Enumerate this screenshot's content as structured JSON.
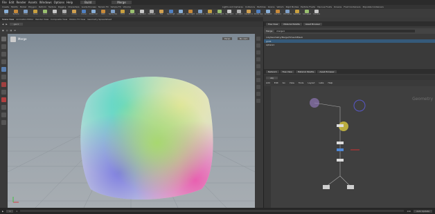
{
  "menu": [
    "File",
    "Edit",
    "Render",
    "Assets",
    "Windows",
    "Options",
    "Help",
    "Build",
    "Merge"
  ],
  "shelf_tabs": [
    "Create",
    "Modify",
    "Model",
    "Polygon",
    "Deform",
    "Texture",
    "Rigging",
    "Characters",
    "Guide Process",
    "Terrain FX",
    "Simple FX",
    "Volume",
    "Lights and Cameras",
    "Collisions",
    "Particles",
    "Grains",
    "Vellum",
    "Rigid Bodies",
    "Particle Fluids",
    "Viscous Fluids",
    "Oceans",
    "Fluid Containers",
    "Populate Containers",
    "Container Tools",
    "Pyro FX",
    "FEM",
    "Wires",
    "Crowds",
    "Drive Simulation"
  ],
  "shelf_tools": [
    "Box",
    "Sphere",
    "Tube",
    "Torus",
    "Grid",
    "Null",
    "Line",
    "Circle",
    "Curve",
    "Draw Curve",
    "Path",
    "Spray Paint",
    "Font",
    "Platonic",
    "L-System",
    "Metaball",
    "File",
    "Spot Light",
    "Area Light",
    "Geo Light",
    "Volume Light",
    "Distant Light",
    "Env Light",
    "Sky Light",
    "GI Light",
    "Caustic Light",
    "Portal Light",
    "Ambient",
    "Camera",
    "VR Camera",
    "Switcher",
    "Gamepad",
    "Camera"
  ],
  "scene_tabs": [
    "Scene View",
    "Animation Editor",
    "Render View",
    "Composite View",
    "Motion FX View",
    "Geometry Spreadsheet"
  ],
  "viewport": {
    "title": "Merge",
    "persp": "Persp",
    "cam": "No cam",
    "obj_path": "geo1",
    "corner_icon": "view-icon"
  },
  "param_panel": {
    "tabs": [
      "Tree View",
      "Material Palette",
      "Asset Browser"
    ],
    "node_type": "Merge",
    "node_name": "merge1",
    "tree_path": "/obj/Geometry/Merge/Timeshift/sub",
    "rows": [
      "grid1",
      "sphere1"
    ]
  },
  "network": {
    "tabs": [
      "Network",
      "Tree View",
      "Material Palette",
      "Asset Browser"
    ],
    "menu": [
      "Add",
      "Edit",
      "Go",
      "View",
      "Tools",
      "Layout",
      "Labs",
      "Help"
    ],
    "label": "Geometry",
    "path": "obj"
  },
  "timeline": {
    "frame": "1",
    "start": "1",
    "end": "240",
    "fps_label": "Auto Update"
  }
}
